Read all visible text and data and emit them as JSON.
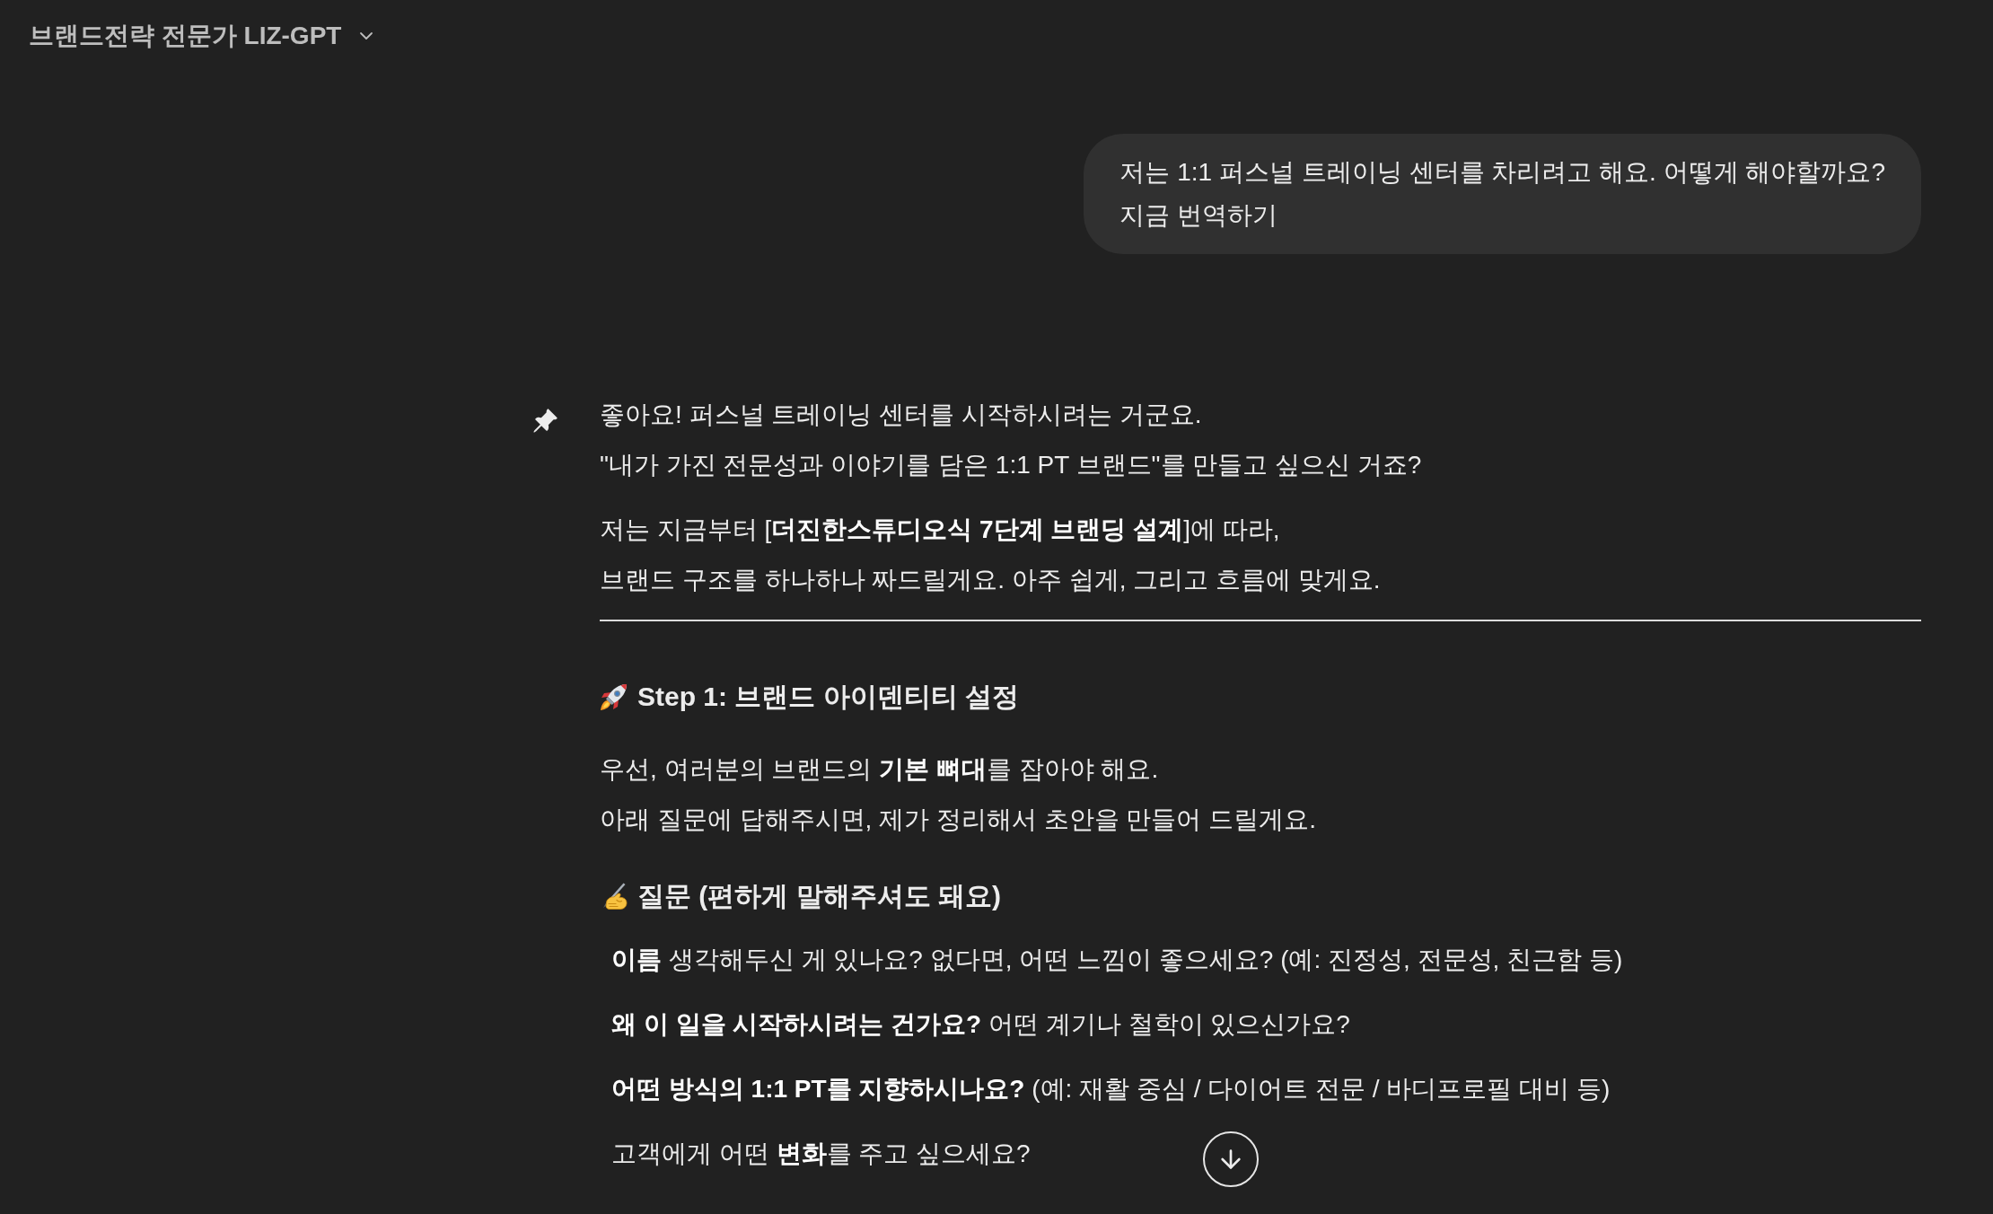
{
  "header": {
    "title": "브랜드전략 전문가 LIZ-GPT"
  },
  "messages": [
    {
      "kind": "user",
      "lines": [
        "저는 1:1 퍼스널 트레이닝 센터를 차리려고 해요. 어떻게 해야할까요?",
        "지금 번역하기"
      ]
    },
    {
      "kind": "assistant",
      "blocks": [
        {
          "kind": "paragraph",
          "lines": [
            "좋아요! 퍼스널 트레이닝 센터를 시작하시려는 거군요.",
            "\"내가 가진 전문성과 이야기를 담은 1:1 PT 브랜드\"를 만들고 싶으신 거죠?"
          ]
        },
        {
          "kind": "paragraph",
          "lines": [
            "저는 지금부터 [**더진한스튜디오식 7단계 브랜딩 설계**]에 따라,",
            "브랜드 구조를 하나하나 짜드릴게요. 아주 쉽게, 그리고 흐름에 맞게요."
          ]
        },
        {
          "kind": "rule"
        },
        {
          "kind": "heading",
          "text": "Step 1: 브랜드 아이덴티티 설정"
        },
        {
          "kind": "paragraph",
          "lines": [
            "우선, 여러분의 브랜드의 **기본 뼈대**를 잡아야 해요.",
            "아래 질문에 답해주시면, 제가 정리해서 초안을 만들어 드릴게요."
          ]
        },
        {
          "kind": "heading",
          "text": "질문 (편하게 말해주셔도 돼요)"
        },
        {
          "kind": "item",
          "text": "**이름** 생각해두신 게 있나요? 없다면, 어떤 느낌이 좋으세요? (예: 진정성, 전문성, 친근함 등)"
        },
        {
          "kind": "item",
          "text": "**왜 이 일을 시작하시려는 건가요?** 어떤 계기나 철학이 있으신가요?"
        },
        {
          "kind": "item",
          "text": "**어떤 방식의 1:1 PT를 지향하시나요?** (예: 재활 중심 / 다이어트 전문 / 바디프로필 대비 등)"
        },
        {
          "kind": "item",
          "text": "고객에게 어떤 **변화**를 주고 싶으세요?"
        }
      ]
    }
  ]
}
